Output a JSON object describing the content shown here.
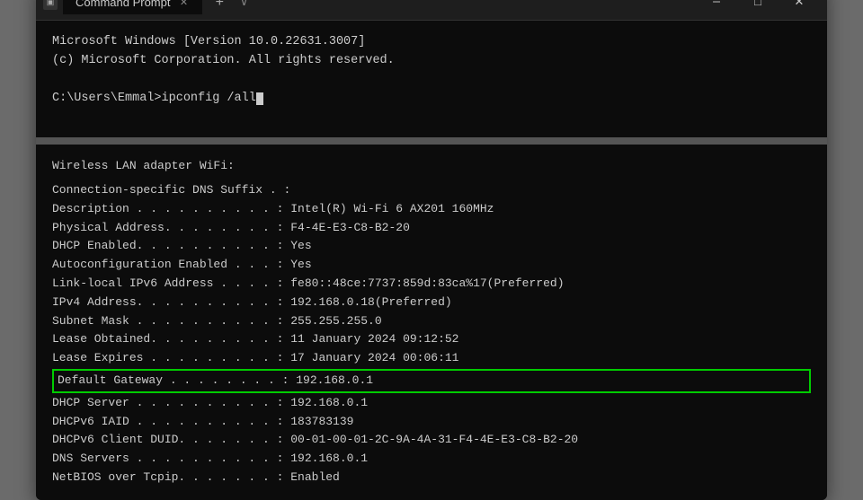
{
  "window": {
    "title": "Command Prompt",
    "tab_icon": "▣"
  },
  "titlebar": {
    "tab_label": "Command Prompt",
    "new_tab": "+",
    "dropdown": "∨",
    "minimize": "─",
    "maximize": "□",
    "close": "✕"
  },
  "terminal": {
    "line1": "Microsoft Windows [Version 10.0.22631.3007]",
    "line2": "(c) Microsoft Corporation. All rights reserved.",
    "line3": "",
    "prompt": "C:\\Users\\Emmal>ipconfig /all"
  },
  "output": {
    "section": "Wireless LAN adapter WiFi:",
    "rows": [
      {
        "label": "   Connection-specific DNS Suffix  . :",
        "value": ""
      },
      {
        "label": "   Description . . . . . . . . . . :",
        "value": " Intel(R) Wi-Fi 6 AX201 160MHz"
      },
      {
        "label": "   Physical Address. . . . . . . . :",
        "value": " F4-4E-E3-C8-B2-20"
      },
      {
        "label": "   DHCP Enabled. . . . . . . . . . :",
        "value": " Yes"
      },
      {
        "label": "   Autoconfiguration Enabled . . . :",
        "value": " Yes"
      },
      {
        "label": "   Link-local IPv6 Address . . . . :",
        "value": " fe80::48ce:7737:859d:83ca%17(Preferred)"
      },
      {
        "label": "   IPv4 Address. . . . . . . . . . :",
        "value": " 192.168.0.18(Preferred)"
      },
      {
        "label": "   Subnet Mask . . . . . . . . . . :",
        "value": " 255.255.255.0"
      },
      {
        "label": "   Lease Obtained. . . . . . . . . :",
        "value": " 11 January 2024 09:12:52"
      },
      {
        "label": "   Lease Expires . . . . . . . . . :",
        "value": " 17 January 2024 00:06:11"
      },
      {
        "label": "   Default Gateway . . . . . . . . :",
        "value": " 192.168.0.1",
        "highlight": true
      },
      {
        "label": "   DHCP Server . . . . . . . . . . :",
        "value": " 192.168.0.1"
      },
      {
        "label": "   DHCPv6 IAID . . . . . . . . . . :",
        "value": " 183783139"
      },
      {
        "label": "   DHCPv6 Client DUID. . . . . . . :",
        "value": " 00-01-00-01-2C-9A-4A-31-F4-4E-E3-C8-B2-20"
      },
      {
        "label": "   DNS Servers . . . . . . . . . . :",
        "value": " 192.168.0.1"
      },
      {
        "label": "   NetBIOS over Tcpip. . . . . . . :",
        "value": " Enabled"
      }
    ]
  }
}
